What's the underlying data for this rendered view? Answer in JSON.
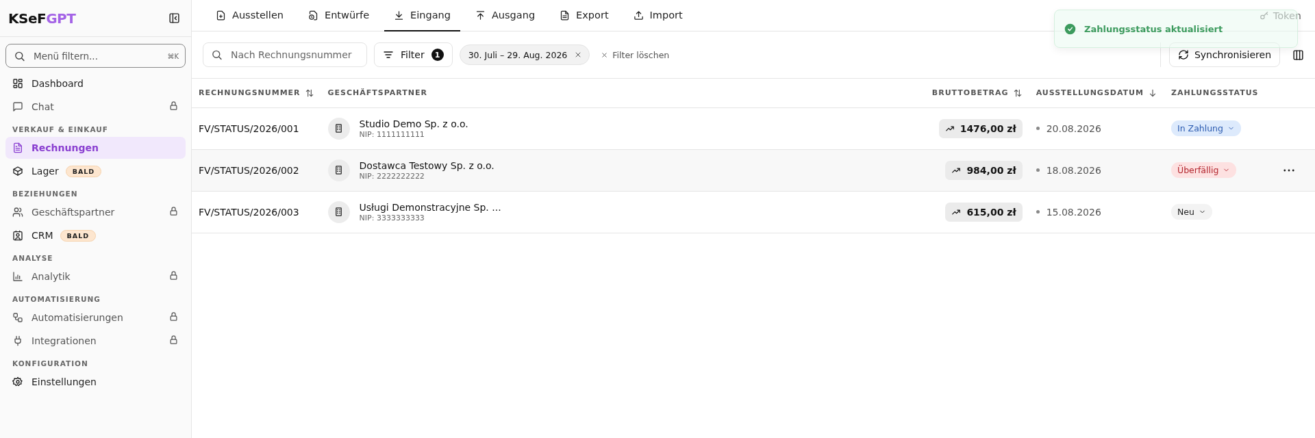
{
  "sidebar": {
    "logo": {
      "dark": "KSeF",
      "accent": "GPT"
    },
    "search": {
      "placeholder": "Menü filtern...",
      "shortcut": "⌘K"
    },
    "sections": [
      {
        "items": [
          {
            "label": "Dashboard",
            "selected": false,
            "locked": false
          },
          {
            "label": "Chat",
            "selected": false,
            "locked": true
          }
        ]
      },
      {
        "title": "VERKAUF & EINKAUF",
        "items": [
          {
            "label": "Rechnungen",
            "selected": true,
            "locked": false
          },
          {
            "label": "Lager",
            "selected": false,
            "locked": false,
            "badge": "BALD"
          }
        ]
      },
      {
        "title": "BEZIEHUNGEN",
        "items": [
          {
            "label": "Geschäftspartner",
            "selected": false,
            "locked": true
          },
          {
            "label": "CRM",
            "selected": false,
            "locked": false,
            "badge": "BALD"
          }
        ]
      },
      {
        "title": "ANALYSE",
        "items": [
          {
            "label": "Analytik",
            "selected": false,
            "locked": true
          }
        ]
      },
      {
        "title": "AUTOMATISIERUNG",
        "items": [
          {
            "label": "Automatisierungen",
            "selected": false,
            "locked": true
          },
          {
            "label": "Integrationen",
            "selected": false,
            "locked": true
          }
        ]
      },
      {
        "title": "KONFIGURATION",
        "items": [
          {
            "label": "Einstellungen",
            "selected": false,
            "locked": false
          }
        ]
      }
    ]
  },
  "tabs": [
    {
      "label": "Ausstellen",
      "selected": false
    },
    {
      "label": "Entwürfe",
      "selected": false
    },
    {
      "label": "Eingang",
      "selected": true
    },
    {
      "label": "Ausgang",
      "selected": false
    },
    {
      "label": "Export",
      "selected": false
    },
    {
      "label": "Import",
      "selected": false
    }
  ],
  "token": "Token",
  "toolbar": {
    "search_placeholder": "Nach Rechnungsnummer",
    "filter": "Filter",
    "filter_count": "1",
    "chip": "30. Juli – 29. Aug. 2026",
    "clear": "Filter löschen",
    "sync": "Synchronisieren"
  },
  "table": {
    "columns": [
      {
        "label": "RECHNUNGSNUMMER",
        "kind": "sortable"
      },
      {
        "label": "GESCHÄFTSPARTNER",
        "kind": "plain"
      },
      {
        "label": "BRUTTOBETRAG",
        "kind": "sortable"
      },
      {
        "label": "AUSSTELLUNGSDATUM",
        "kind": "sorted"
      },
      {
        "label": "ZAHLUNGSSTATUS",
        "kind": "plain"
      }
    ],
    "rows": [
      {
        "number": "FV/STATUS/2026/001",
        "partner": "Studio Demo Sp. z o.o.",
        "nip": "NIP: 1111111111",
        "amount": "1476,00 zł",
        "date": "20.08.2026",
        "status": "In Zahlung",
        "kind": "paying",
        "hovered": false
      },
      {
        "number": "FV/STATUS/2026/002",
        "partner": "Dostawca Testowy Sp. z o.o.",
        "nip": "NIP: 2222222222",
        "amount": "984,00 zł",
        "date": "18.08.2026",
        "status": "Überfällig",
        "kind": "overdue",
        "hovered": true
      },
      {
        "number": "FV/STATUS/2026/003",
        "partner": "Usługi Demonstracyjne Sp. ...",
        "nip": "NIP: 3333333333",
        "amount": "615,00 zł",
        "date": "15.08.2026",
        "status": "Neu",
        "kind": "new",
        "hovered": false
      }
    ]
  },
  "toast": {
    "message": "Zahlungsstatus aktualisiert"
  }
}
